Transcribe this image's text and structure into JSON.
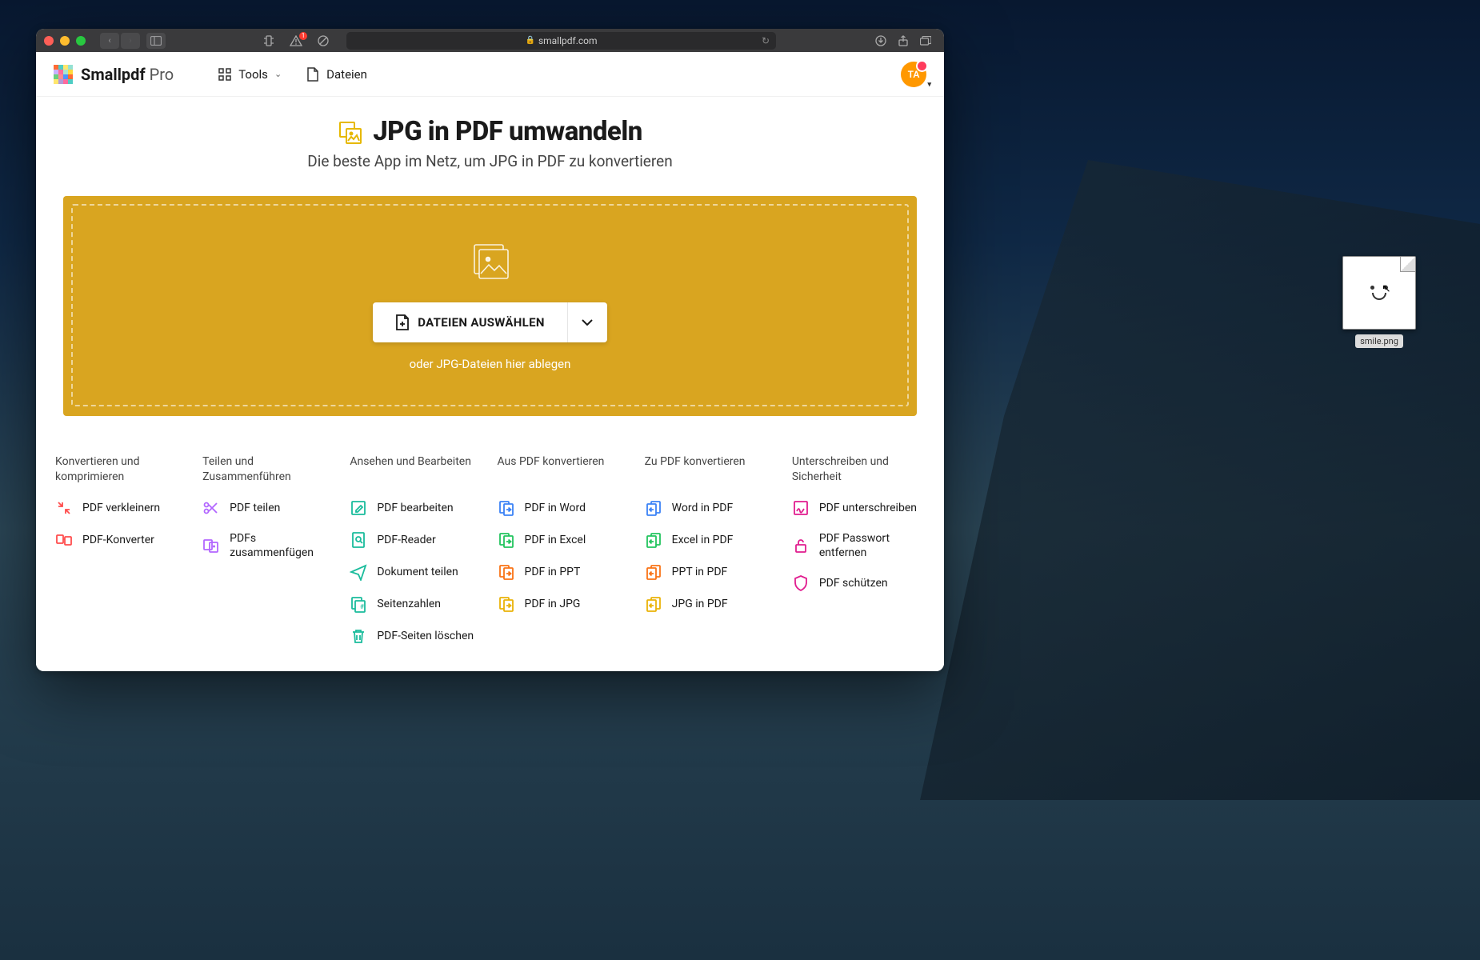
{
  "browser": {
    "url": "smallpdf.com",
    "badge_count": "1"
  },
  "header": {
    "brand": "Smallpdf",
    "tier": "Pro",
    "tools_label": "Tools",
    "files_label": "Dateien",
    "avatar_initials": "TA"
  },
  "hero": {
    "title": "JPG in PDF umwandeln",
    "subtitle": "Die beste App im Netz, um JPG in PDF zu konvertieren"
  },
  "dropzone": {
    "button_label": "DATEIEN AUSWÄHLEN",
    "hint": "oder JPG-Dateien hier ablegen"
  },
  "tool_columns": [
    {
      "heading": "Konvertieren und komprimieren",
      "items": [
        {
          "label": "PDF verkleinern",
          "icon": "compress",
          "color": "#ff4d4d"
        },
        {
          "label": "PDF-Konverter",
          "icon": "convert",
          "color": "#ff4d4d"
        }
      ]
    },
    {
      "heading": "Teilen und Zusammenführen",
      "items": [
        {
          "label": "PDF teilen",
          "icon": "split",
          "color": "#b266ff"
        },
        {
          "label": "PDFs zusammenfügen",
          "icon": "merge",
          "color": "#b266ff"
        }
      ]
    },
    {
      "heading": "Ansehen und Bearbeiten",
      "items": [
        {
          "label": "PDF bearbeiten",
          "icon": "edit",
          "color": "#1abc9c"
        },
        {
          "label": "PDF-Reader",
          "icon": "reader",
          "color": "#1abc9c"
        },
        {
          "label": "Dokument teilen",
          "icon": "send",
          "color": "#1abc9c"
        },
        {
          "label": "Seitenzahlen",
          "icon": "numbers",
          "color": "#1abc9c"
        },
        {
          "label": "PDF-Seiten löschen",
          "icon": "delete",
          "color": "#1abc9c"
        }
      ]
    },
    {
      "heading": "Aus PDF konvertieren",
      "items": [
        {
          "label": "PDF in Word",
          "icon": "to-doc",
          "color": "#3b82f6"
        },
        {
          "label": "PDF in Excel",
          "icon": "to-doc",
          "color": "#22c55e"
        },
        {
          "label": "PDF in PPT",
          "icon": "to-doc",
          "color": "#f97316"
        },
        {
          "label": "PDF in JPG",
          "icon": "to-doc",
          "color": "#eab308"
        }
      ]
    },
    {
      "heading": "Zu PDF konvertieren",
      "items": [
        {
          "label": "Word in PDF",
          "icon": "from-doc",
          "color": "#3b82f6"
        },
        {
          "label": "Excel in PDF",
          "icon": "from-doc",
          "color": "#22c55e"
        },
        {
          "label": "PPT in PDF",
          "icon": "from-doc",
          "color": "#f97316"
        },
        {
          "label": "JPG in PDF",
          "icon": "from-doc",
          "color": "#eab308"
        }
      ]
    },
    {
      "heading": "Unterschreiben und Sicherheit",
      "items": [
        {
          "label": "PDF unterschreiben",
          "icon": "sign",
          "color": "#e11d8f"
        },
        {
          "label": "PDF Passwort entfernen",
          "icon": "unlock",
          "color": "#e11d8f"
        },
        {
          "label": "PDF schützen",
          "icon": "shield",
          "color": "#e11d8f"
        }
      ]
    }
  ],
  "desktop_file": {
    "name": "smile.png"
  }
}
